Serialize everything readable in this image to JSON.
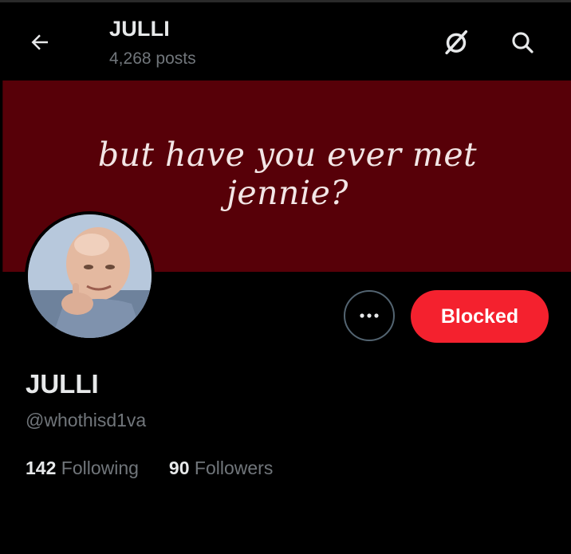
{
  "header": {
    "title": "JULLI",
    "posts_count": "4,268 posts",
    "back_icon": "arrow-left-icon",
    "grok_icon": "grok-icon",
    "search_icon": "search-icon"
  },
  "banner": {
    "line1": "but have you ever met",
    "line2": "jennie?",
    "background": "#570008"
  },
  "profile": {
    "display_name": "JULLI",
    "handle": "@whothisd1va",
    "following_count": "142",
    "following_label": "Following",
    "followers_count": "90",
    "followers_label": "Followers"
  },
  "actions": {
    "more_icon": "more-horizontal-icon",
    "blocked_label": "Blocked",
    "blocked_color": "#f4212e"
  }
}
